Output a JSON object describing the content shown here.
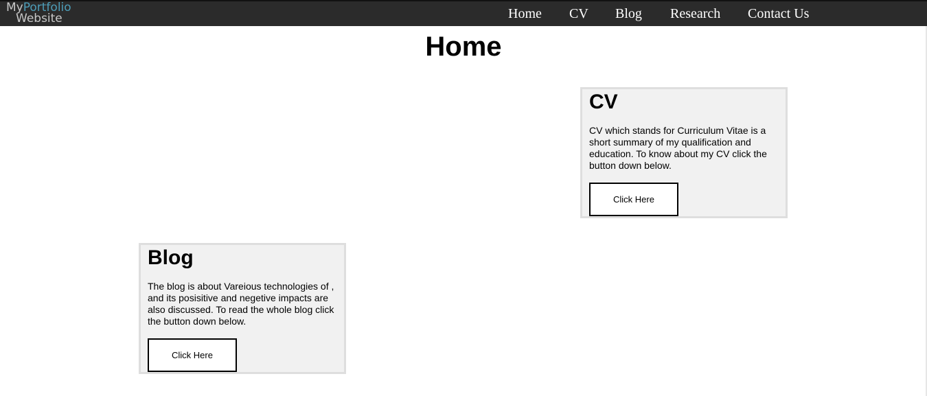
{
  "navbar": {
    "logo": {
      "line1_a": "My",
      "line1_b": "Portfolio",
      "line2": "Website"
    },
    "links": [
      "Home",
      "CV",
      "Blog",
      "Research",
      "Contact Us"
    ]
  },
  "page": {
    "title": "Home"
  },
  "cards": {
    "cv": {
      "title": "CV",
      "text": "CV which stands for Curriculum Vitae is a short summary of my qualification and education. To know about my CV click the button down below.",
      "button": "Click Here"
    },
    "blog": {
      "title": "Blog",
      "text": "The blog is about Vareious technologies of , and its posisitive and negetive impacts are also discussed. To read the whole blog click the button down below.",
      "button": "Click Here"
    }
  },
  "colors": {
    "navbar_bg": "#2b2b2b",
    "logo_accent": "#4d9db8",
    "card_bg": "#f1f1f1",
    "card_border": "#dedede"
  }
}
